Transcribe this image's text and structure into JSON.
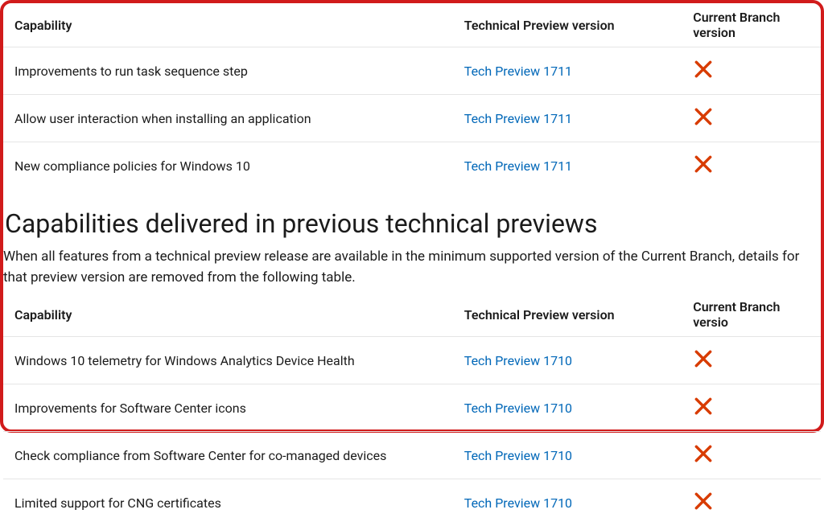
{
  "table1": {
    "headers": {
      "capability": "Capability",
      "preview": "Technical Preview version",
      "branch": "Current Branch version"
    },
    "rows": [
      {
        "capability": "Improvements to run task sequence step",
        "preview": "Tech Preview 1711",
        "branch": "x"
      },
      {
        "capability": "Allow user interaction when installing an application",
        "preview": "Tech Preview 1711",
        "branch": "x"
      },
      {
        "capability": "New compliance policies for Windows 10",
        "preview": "Tech Preview 1711",
        "branch": "x"
      }
    ]
  },
  "section": {
    "heading": "Capabilities delivered in previous technical previews",
    "description": "When all features from a technical preview release are available in the minimum supported version of the Current Branch, details for that preview version are removed from the following table."
  },
  "table2": {
    "headers": {
      "capability": "Capability",
      "preview": "Technical Preview version",
      "branch": "Current Branch versio"
    },
    "rows": [
      {
        "capability": "Windows 10 telemetry for Windows Analytics Device Health",
        "preview": "Tech Preview 1710",
        "branch": "x"
      },
      {
        "capability": "Improvements for Software Center icons",
        "preview": "Tech Preview 1710",
        "branch": "x"
      },
      {
        "capability": "Check compliance from Software Center for co-managed devices",
        "preview": "Tech Preview 1710",
        "branch": "x"
      },
      {
        "capability": "Limited support for CNG certificates",
        "preview": "Tech Preview 1710",
        "branch": "x"
      }
    ]
  },
  "icons": {
    "x": "cross-icon"
  },
  "colors": {
    "link": "#0067b8",
    "frame": "#d11b1b",
    "x": "#d83b01"
  }
}
